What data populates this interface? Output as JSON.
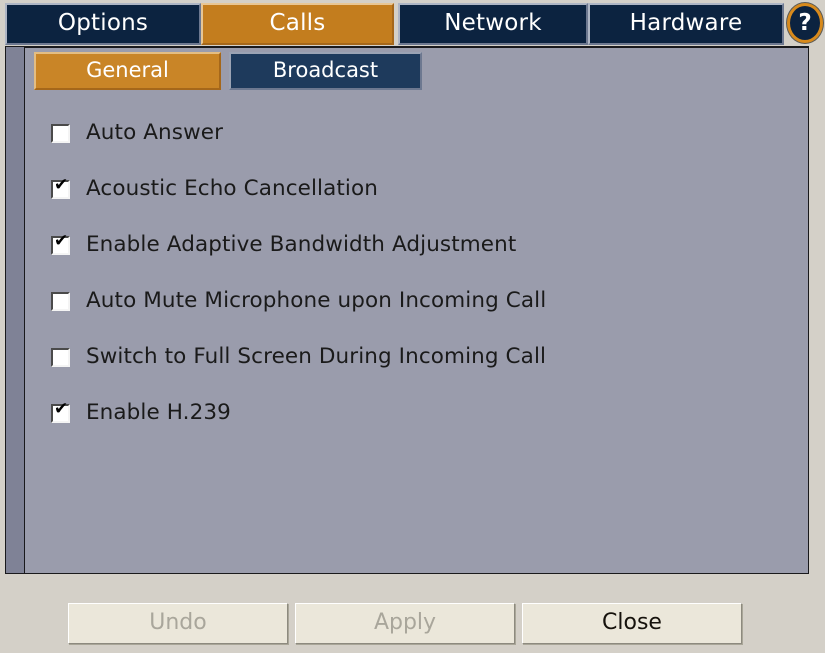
{
  "tabs": [
    {
      "label": "Options",
      "active": false
    },
    {
      "label": "Calls",
      "active": true
    },
    {
      "label": "Network",
      "active": false
    },
    {
      "label": "Hardware",
      "active": false
    }
  ],
  "help": {
    "glyph": "?",
    "tooltip": "Help"
  },
  "subtabs": [
    {
      "label": "General",
      "active": true
    },
    {
      "label": "Broadcast",
      "active": false
    }
  ],
  "settings": [
    {
      "label": "Auto Answer",
      "checked": false
    },
    {
      "label": "Acoustic Echo Cancellation",
      "checked": true
    },
    {
      "label": "Enable Adaptive Bandwidth Adjustment",
      "checked": true
    },
    {
      "label": "Auto Mute Microphone upon Incoming Call",
      "checked": false
    },
    {
      "label": "Switch to Full Screen During Incoming Call",
      "checked": false
    },
    {
      "label": "Enable H.239",
      "checked": true
    }
  ],
  "footer": {
    "undo": {
      "label": "Undo",
      "enabled": false
    },
    "apply": {
      "label": "Apply",
      "enabled": false
    },
    "close": {
      "label": "Close",
      "enabled": true
    }
  },
  "checkmark": "✔",
  "colors": {
    "tab_active": "#c37d1e",
    "tab_inactive": "#0c2340",
    "subtab_active": "#c98527",
    "subtab_inactive": "#1e3a5c",
    "panel": "#9a9cac",
    "panel_edge": "#7f8296",
    "window_bg": "#d4d0c8",
    "button_face": "#ebe7da",
    "help_ring": "#d88a1c"
  }
}
